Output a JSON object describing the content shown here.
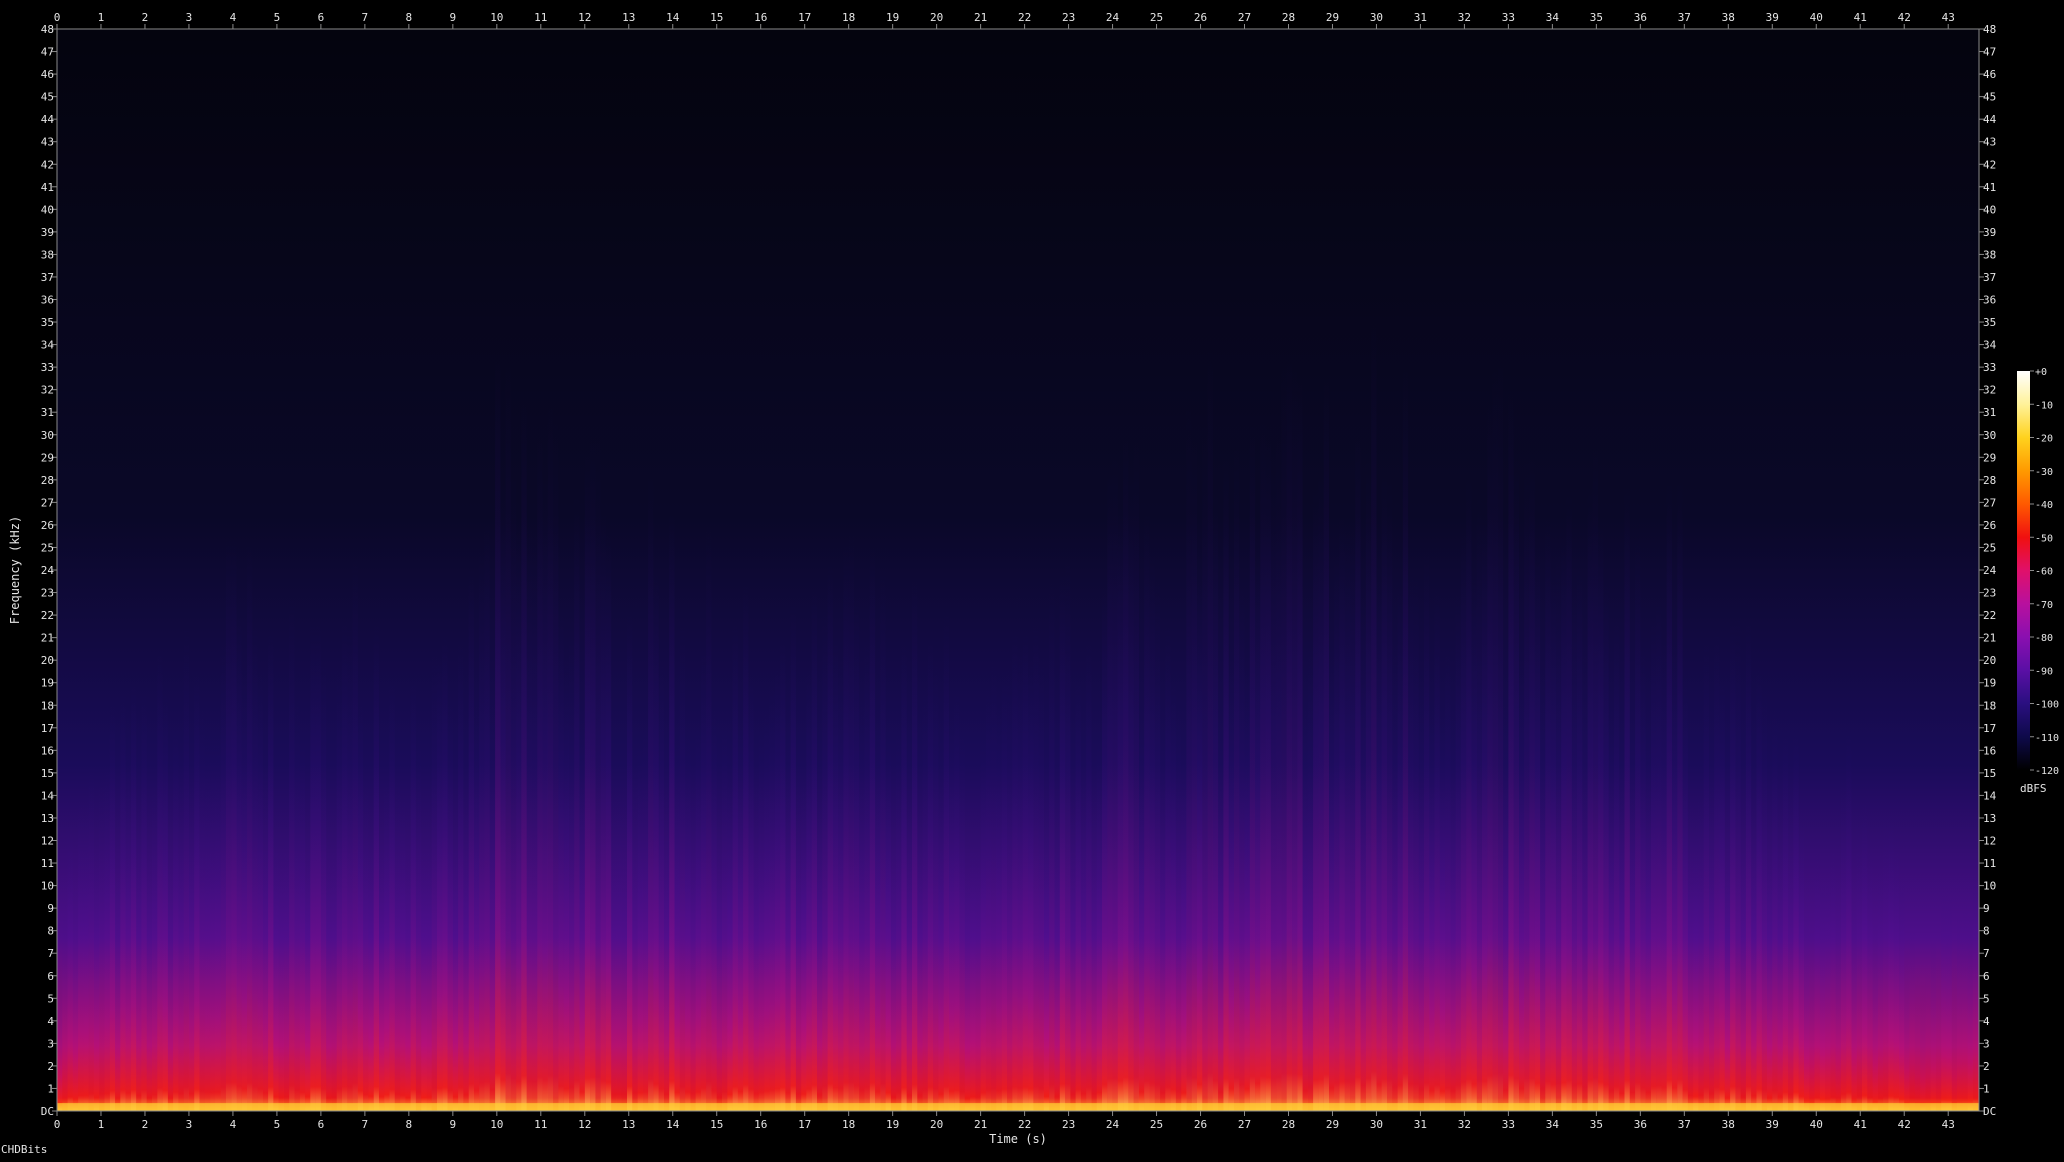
{
  "watermark": "CHDBits",
  "chart_data": {
    "type": "heatmap",
    "title": "",
    "xlabel": "Time (s)",
    "ylabel": "Frequency (kHz)",
    "xlim": [
      0,
      43.7
    ],
    "ylim": [
      0,
      48
    ],
    "x_ticks": [
      "0",
      "1",
      "2",
      "3",
      "4",
      "5",
      "6",
      "7",
      "8",
      "9",
      "10",
      "11",
      "12",
      "13",
      "14",
      "15",
      "16",
      "17",
      "18",
      "19",
      "20",
      "21",
      "22",
      "23",
      "24",
      "25",
      "26",
      "27",
      "28",
      "29",
      "30",
      "31",
      "32",
      "33",
      "34",
      "35",
      "36",
      "37",
      "38",
      "39",
      "40",
      "41",
      "42",
      "43"
    ],
    "y_ticks": [
      "DC",
      "1",
      "2",
      "3",
      "4",
      "5",
      "6",
      "7",
      "8",
      "9",
      "10",
      "11",
      "12",
      "13",
      "14",
      "15",
      "16",
      "17",
      "18",
      "19",
      "20",
      "21",
      "22",
      "23",
      "24",
      "25",
      "26",
      "27",
      "28",
      "29",
      "30",
      "31",
      "32",
      "33",
      "34",
      "35",
      "36",
      "37",
      "38",
      "39",
      "40",
      "41",
      "42",
      "43",
      "44",
      "45",
      "46",
      "47",
      "48"
    ],
    "x_ticks_top": true,
    "y_ticks_right": true,
    "grid": false,
    "colorbar": {
      "label": "dBFS",
      "range": [
        -120,
        0
      ],
      "ticks": [
        "+0",
        "-10",
        "-20",
        "-30",
        "-40",
        "-50",
        "-60",
        "-70",
        "-80",
        "-90",
        "-100",
        "-110",
        "-120"
      ],
      "colormap": [
        "#ffffff",
        "#fff29a",
        "#ffd21e",
        "#ff9a00",
        "#ff5a00",
        "#f01010",
        "#e0106a",
        "#b8109e",
        "#8a0fb0",
        "#5a0fa5",
        "#2a0f80",
        "#0e0a4a",
        "#000000"
      ]
    },
    "energy_envelope": {
      "x": [
        0,
        1,
        2,
        3,
        4,
        5,
        6,
        7,
        8,
        9,
        10,
        11,
        12,
        13,
        14,
        15,
        16,
        17,
        18,
        19,
        20,
        21,
        22,
        23,
        24,
        25,
        26,
        27,
        28,
        29,
        30,
        31,
        32,
        33,
        34,
        35,
        36,
        37,
        38,
        39,
        40,
        41,
        42,
        43.7
      ],
      "upper_freq_khz": [
        12,
        16,
        18,
        20,
        24,
        20,
        20,
        24,
        20,
        18,
        30,
        32,
        28,
        24,
        26,
        22,
        20,
        20,
        24,
        22,
        20,
        18,
        20,
        22,
        30,
        28,
        30,
        28,
        32,
        30,
        32,
        30,
        28,
        30,
        26,
        26,
        28,
        24,
        20,
        18,
        12,
        16,
        10,
        10
      ]
    }
  }
}
